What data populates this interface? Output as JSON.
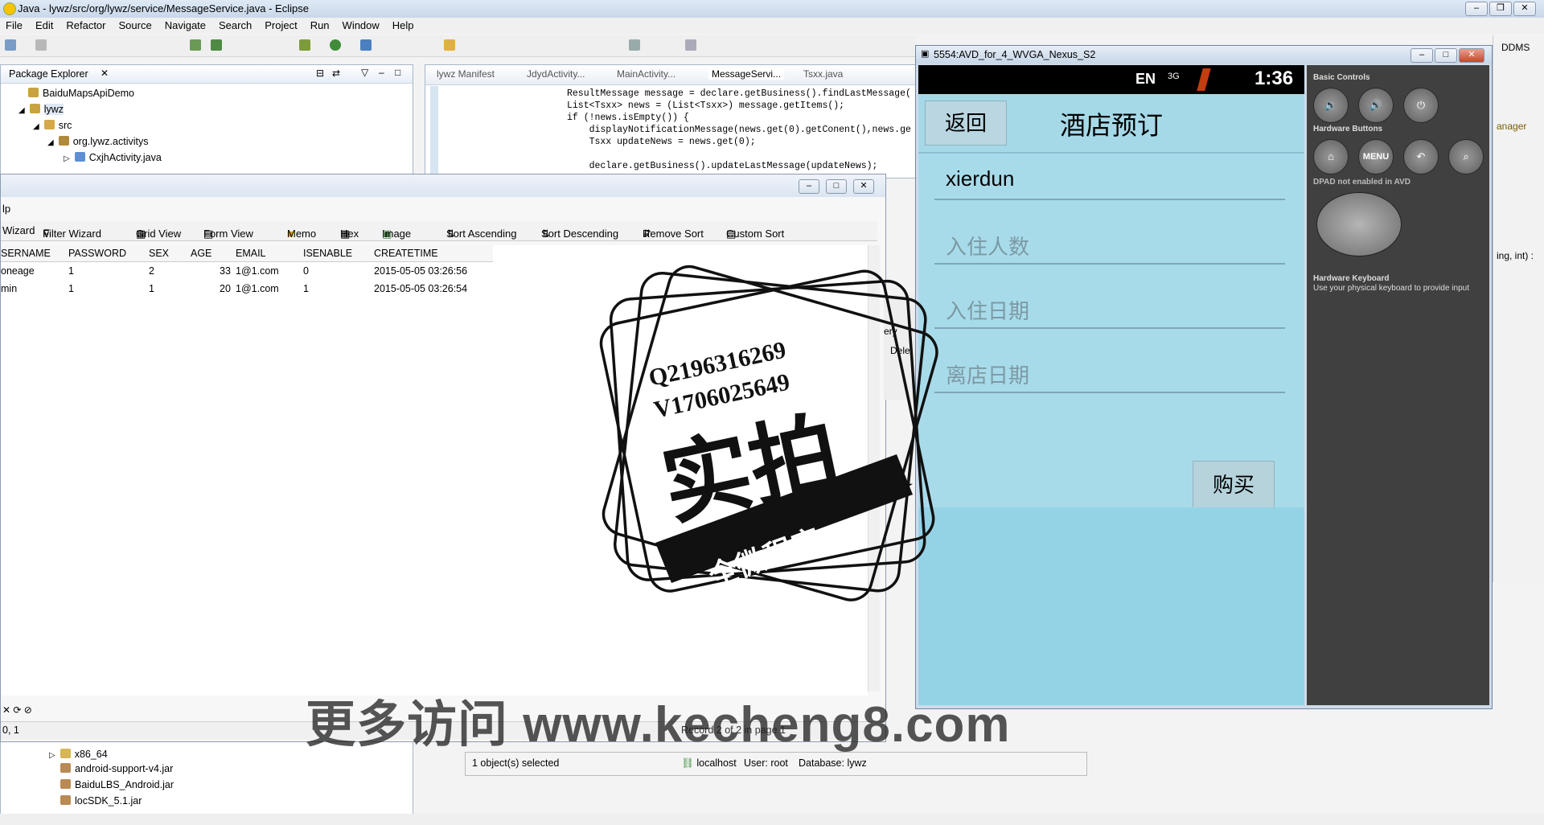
{
  "window": {
    "title": "Java - lywz/src/org/lywz/service/MessageService.java - Eclipse"
  },
  "menu": [
    "File",
    "Edit",
    "Refactor",
    "Source",
    "Navigate",
    "Search",
    "Project",
    "Run",
    "Window",
    "Help"
  ],
  "package_explorer": {
    "tab": "Package Explorer",
    "items": [
      "BaiduMapsApiDemo",
      "lywz",
      "src",
      "org.lywz.activitys",
      "CxjhActivity.java"
    ],
    "lower_items": [
      "x86_64",
      "android-support-v4.jar",
      "BaiduLBS_Android.jar",
      "locSDK_5.1.jar"
    ]
  },
  "editor": {
    "tabs": [
      "lywz Manifest",
      "JdydActivity...",
      "MainActivity...",
      "MessageServi...",
      "Tsxx.java"
    ],
    "code": [
      "ResultMessage message = declare.getBusiness().findLastMessage(",
      "List<Tsxx> news = (List<Tsxx>) message.getItems();",
      "if (!news.isEmpty()) {",
      "    displayNotificationMessage(news.get(0).getConent(),news.ge",
      "    Tsxx updateNews = news.get(0);",
      "",
      "    declare.getBusiness().updateLastMessage(updateNews);"
    ]
  },
  "navicat": {
    "menu_fragment": "lp",
    "toolbar": [
      "Wizard",
      "Filter Wizard",
      "Grid View",
      "Form View",
      "Memo",
      "Hex",
      "Image",
      "Sort Ascending",
      "Sort Descending",
      "Remove Sort",
      "Custom Sort"
    ],
    "columns": [
      "SERNAME",
      "PASSWORD",
      "SEX",
      "AGE",
      "EMAIL",
      "ISENABLE",
      "CREATETIME"
    ],
    "rows": [
      [
        "oneage",
        "1",
        "2",
        "33",
        "1@1.com",
        "0",
        "2015-05-05 03:26:56"
      ],
      [
        "min",
        "1",
        "1",
        "20",
        "1@1.com",
        "1",
        "2015-05-05 03:26:54"
      ]
    ],
    "side_labels": [
      "ery",
      "Delet"
    ],
    "status_left": "0, 1",
    "status_record": "Record 2 of 2 in page 1"
  },
  "navicat_main_status": {
    "selected": "1 object(s) selected",
    "host": "localhost",
    "user": "User: root",
    "database": "Database: lywz"
  },
  "right_fragments": [
    "anager",
    "ing, int) :",
    "DDMS"
  ],
  "emulator": {
    "title": "5554:AVD_for_4_WVGA_Nexus_S2",
    "status_lang": "EN",
    "status_net": "3G",
    "time": "1:36",
    "back_label": "返回",
    "app_title": "酒店预订",
    "name_value": "xierdun",
    "guests_placeholder": "入住人数",
    "checkin_placeholder": "入住日期",
    "checkout_placeholder": "离店日期",
    "buy_label": "购买",
    "controls": {
      "basic_label": "Basic Controls",
      "hardware_label": "Hardware Buttons",
      "menu_label": "MENU",
      "dpad_label": "DPAD not enabled in AVD",
      "keyboard_label": "Hardware Keyboard",
      "keyboard_note": "Use your physical keyboard to provide input"
    }
  },
  "stamp": {
    "line1": "Q2196316269",
    "line2": "V1706025649",
    "big": "实拍",
    "ribbon": "全微程序"
  },
  "watermark": "更多访问 www.kecheng8.com"
}
